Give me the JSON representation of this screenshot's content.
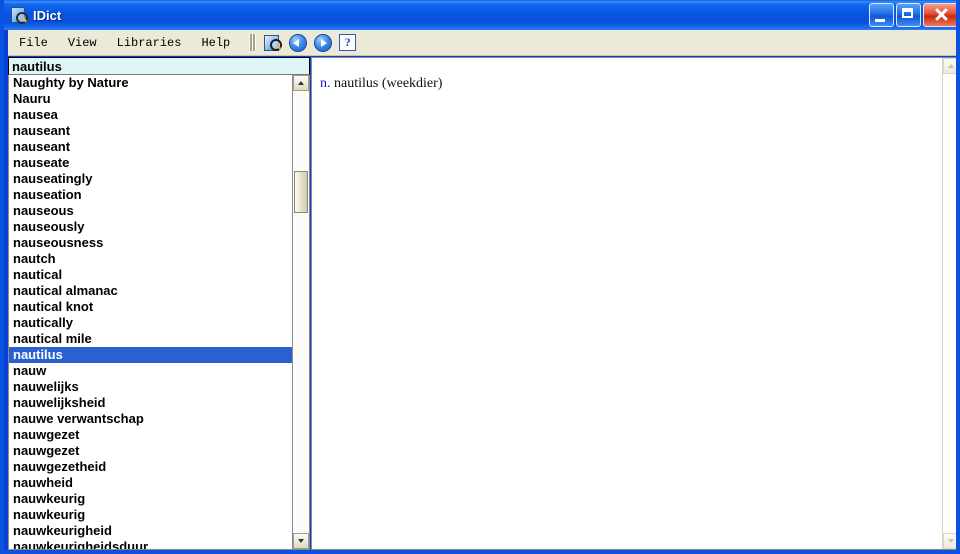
{
  "window": {
    "title": "IDict",
    "icon": "dictionary-magnifier-icon",
    "controls": {
      "minimize": "Minimize",
      "maximize": "Maximize",
      "close": "Close"
    }
  },
  "menu": {
    "items": [
      {
        "label": "File"
      },
      {
        "label": "View"
      },
      {
        "label": "Libraries"
      },
      {
        "label": "Help"
      }
    ]
  },
  "toolbar": {
    "buttons": [
      {
        "icon": "dictionary-search-icon",
        "title": "Search"
      },
      {
        "icon": "back-arrow-icon",
        "title": "Back"
      },
      {
        "icon": "forward-arrow-icon",
        "title": "Forward"
      },
      {
        "icon": "help-question-icon",
        "title": "Help"
      }
    ]
  },
  "search": {
    "value": "nautilus",
    "placeholder": ""
  },
  "wordlist": {
    "selected": "nautilus",
    "items": [
      "Naughty by Nature",
      "Nauru",
      "nausea",
      "nauseant",
      "nauseant",
      "nauseate",
      "nauseatingly",
      "nauseation",
      "nauseous",
      "nauseously",
      "nauseousness",
      "nautch",
      "nautical",
      "nautical almanac",
      "nautical knot",
      "nautically",
      "nautical mile",
      "nautilus",
      "nauw",
      "nauwelijks",
      "nauwelijksheid",
      "nauwe verwantschap",
      "nauwgezet",
      "nauwgezet",
      "nauwgezetheid",
      "nauwheid",
      "nauwkeurig",
      "nauwkeurig",
      "nauwkeurigheid",
      "nauwkeurigheidsduur"
    ]
  },
  "definition": {
    "pos": "n.",
    "text": "nautilus (weekdier)"
  },
  "colors": {
    "titlebar_blue": "#0a52e0",
    "selection_blue": "#2a61cf",
    "search_field_bg": "#dff6f6",
    "menu_bar_bg": "#ece9d8",
    "pos_blue": "#1a1ad0",
    "close_red": "#c92a10"
  }
}
